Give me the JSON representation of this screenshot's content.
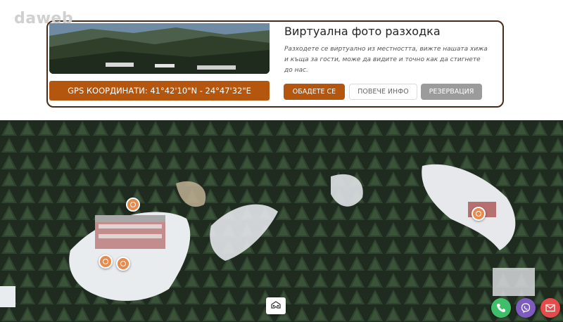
{
  "brand": {
    "watermark": "daweb"
  },
  "card": {
    "title": "Виртуална фото разходка",
    "description": "Разходете се виртуално из местността, вижте нашата хижа и къща за гости, може да видите и точно как да стигнете до нас.",
    "gps_label": "GPS КООРДИНАТИ: 41°42'10\"N - 24°47'32\"E",
    "buttons": {
      "call": "ОБАДЕТЕ СЕ",
      "more_info": "ПОВЕЧЕ ИНФО",
      "reservation": "РЕЗЕРВАЦИЯ"
    }
  },
  "tour": {
    "hotspots": [
      "hotspot-icon",
      "hotspot-icon",
      "hotspot-icon",
      "hotspot-icon"
    ],
    "vr_icon": "vr-headset-icon"
  },
  "contact": {
    "icons": [
      "phone-icon",
      "viber-icon",
      "mail-icon"
    ]
  },
  "colors": {
    "accent": "#b5560f",
    "border": "#4a2a18",
    "reservation_bg": "#9b9b9b",
    "phone": "#3fbf6a",
    "viber": "#7d5bbf",
    "mail": "#e44b4b"
  }
}
